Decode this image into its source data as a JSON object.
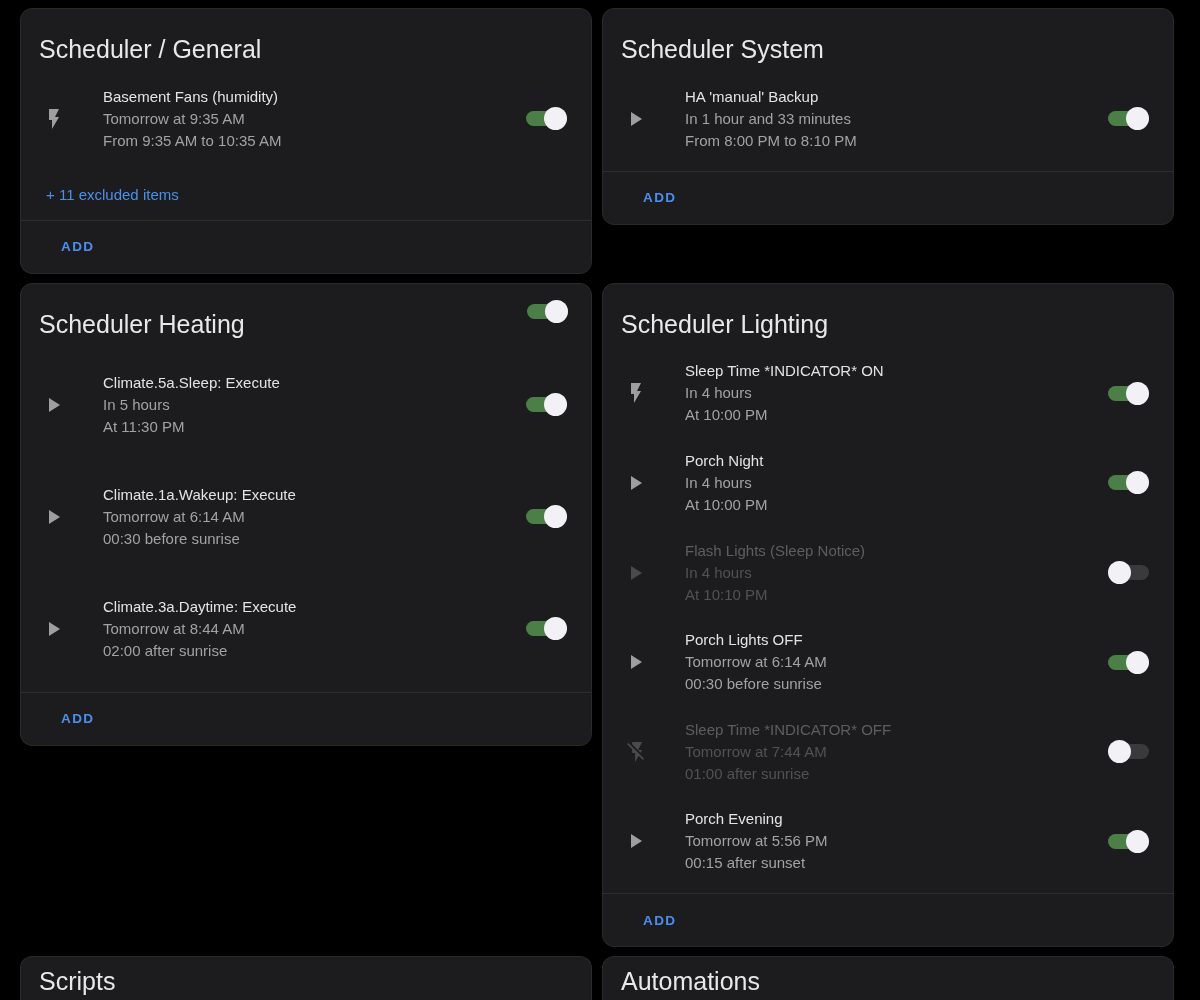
{
  "cards": [
    {
      "title": "Scheduler / General",
      "items": [
        {
          "kind": "flash",
          "name": "Basement Fans (humidity)",
          "next": "Tomorrow at 9:35 AM",
          "time": "From 9:35 AM to 10:35 AM",
          "on": true
        }
      ],
      "excluded": "+ 11 excluded items",
      "add_button": "ADD"
    },
    {
      "title": "Scheduler System",
      "items": [
        {
          "kind": "play",
          "name": "HA 'manual' Backup",
          "next": "In 1 hour and 33 minutes",
          "time": "From 8:00 PM to 8:10 PM",
          "on": true
        }
      ],
      "add_button": "ADD"
    },
    {
      "title": "Scheduler Heating",
      "header_toggle": {
        "on": true
      },
      "items": [
        {
          "kind": "play",
          "name": "Climate.5a.Sleep: Execute",
          "next": "In 5 hours",
          "time": "At 11:30 PM",
          "on": true
        },
        {
          "kind": "play",
          "name": "Climate.1a.Wakeup: Execute",
          "next": "Tomorrow at 6:14 AM",
          "time": "00:30 before sunrise",
          "on": true
        },
        {
          "kind": "play",
          "name": "Climate.3a.Daytime: Execute",
          "next": "Tomorrow at 8:44 AM",
          "time": "02:00 after sunrise",
          "on": true
        }
      ],
      "add_button": "ADD"
    },
    {
      "title": "Scheduler Lighting",
      "items": [
        {
          "kind": "flash",
          "name": "Sleep Time *INDICATOR* ON",
          "next": "In 4 hours",
          "time": "At 10:00 PM",
          "on": true
        },
        {
          "kind": "play",
          "name": "Porch Night",
          "next": "In 4 hours",
          "time": "At 10:00 PM",
          "on": true
        },
        {
          "kind": "play",
          "name": "Flash Lights (Sleep Notice)",
          "next": "In 4 hours",
          "time": "At 10:10 PM",
          "on": false
        },
        {
          "kind": "play",
          "name": "Porch Lights OFF",
          "next": "Tomorrow at 6:14 AM",
          "time": "00:30 before sunrise",
          "on": true
        },
        {
          "kind": "noflash",
          "name": "Sleep Time *INDICATOR* OFF",
          "next": "Tomorrow at 7:44 AM",
          "time": "01:00 after sunrise",
          "on": false
        },
        {
          "kind": "play",
          "name": "Porch Evening",
          "next": "Tomorrow at 5:56 PM",
          "time": "00:15 after sunset",
          "on": true
        }
      ],
      "add_button": "ADD"
    },
    {
      "title": "Scripts"
    },
    {
      "title": "Automations"
    }
  ]
}
